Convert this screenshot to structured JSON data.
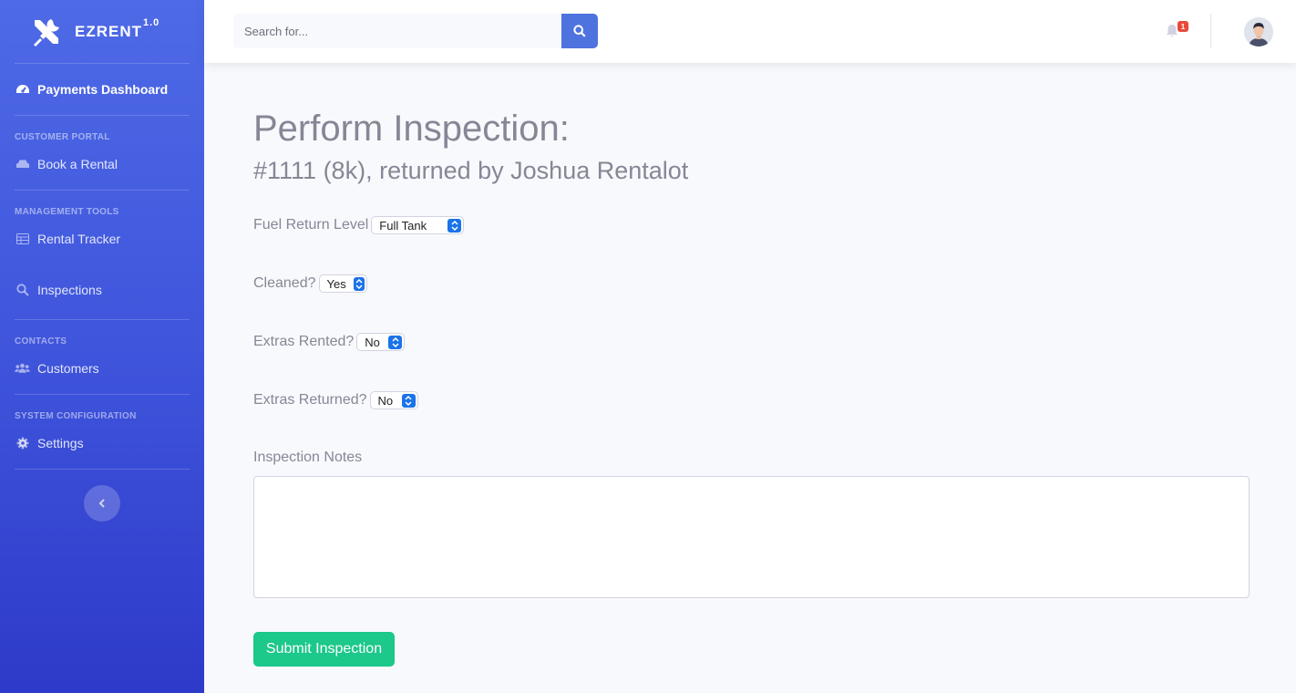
{
  "brand": {
    "name": "EZRENT",
    "version": "1.0"
  },
  "sidebar": {
    "dashboard": "Payments Dashboard",
    "sections": [
      {
        "heading": "CUSTOMER PORTAL",
        "items": [
          "Book a Rental"
        ]
      },
      {
        "heading": "MANAGEMENT TOOLS",
        "items": [
          "Rental Tracker",
          "Inspections"
        ]
      },
      {
        "heading": "CONTACTS",
        "items": [
          "Customers"
        ]
      },
      {
        "heading": "SYSTEM CONFIGURATION",
        "items": [
          "Settings"
        ]
      }
    ]
  },
  "topbar": {
    "search_placeholder": "Search for...",
    "notification_count": "1"
  },
  "page": {
    "title": "Perform Inspection:",
    "subtitle": "#1111 (8k), returned by Joshua Rentalot"
  },
  "form": {
    "fuel_label": "Fuel Return Level",
    "fuel_value": "Full Tank",
    "cleaned_label": "Cleaned?",
    "cleaned_value": "Yes",
    "extras_rented_label": "Extras Rented?",
    "extras_rented_value": "No",
    "extras_returned_label": "Extras Returned?",
    "extras_returned_value": "No",
    "notes_label": "Inspection Notes",
    "notes_value": "",
    "submit_label": "Submit Inspection"
  },
  "colors": {
    "sidebar_top": "#4e6ae6",
    "sidebar_bottom": "#2e3ac9",
    "primary": "#4e73df",
    "success": "#1cc88a",
    "danger": "#e74a3b",
    "text_muted": "#858796"
  }
}
